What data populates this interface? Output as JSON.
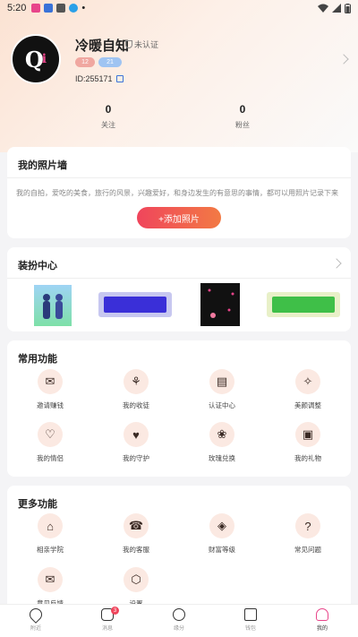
{
  "status": {
    "time": "5:20",
    "dot": "•"
  },
  "profile": {
    "nickname": "冷暖自知",
    "verify_label": "未认证",
    "badge_level": "12",
    "badge_blue": "21",
    "user_id": "ID:255171"
  },
  "stats": [
    {
      "value": "0",
      "label": "关注"
    },
    {
      "value": "0",
      "label": "粉丝"
    }
  ],
  "photo_wall": {
    "title": "我的照片墙",
    "description": "我的自拍，爱吃的美食，旅行的风景，兴趣爱好，和身边发生的有意思的事情，都可以用照片记录下来",
    "add_button": "+添加照片"
  },
  "dress_center": {
    "title": "装扮中心"
  },
  "common_functions": {
    "title": "常用功能",
    "items": [
      {
        "label": "邀请赚钱",
        "icon": "invite-user-icon"
      },
      {
        "label": "我的收徒",
        "icon": "disciple-icon"
      },
      {
        "label": "认证中心",
        "icon": "id-card-icon"
      },
      {
        "label": "美颜调整",
        "icon": "beauty-icon"
      },
      {
        "label": "我的情侣",
        "icon": "couple-icon"
      },
      {
        "label": "我的守护",
        "icon": "guard-icon"
      },
      {
        "label": "玫瑰兑换",
        "icon": "rose-icon"
      },
      {
        "label": "我的礼物",
        "icon": "gift-icon"
      }
    ]
  },
  "more_functions": {
    "title": "更多功能",
    "items": [
      {
        "label": "相亲学院",
        "icon": "school-icon"
      },
      {
        "label": "我的客服",
        "icon": "customer-service-icon"
      },
      {
        "label": "财富等级",
        "icon": "wealth-icon"
      },
      {
        "label": "常见问题",
        "icon": "question-icon"
      },
      {
        "label": "意见反馈",
        "icon": "feedback-icon"
      },
      {
        "label": "设置",
        "icon": "settings-icon"
      }
    ]
  },
  "tabbar": [
    {
      "label": "附近",
      "icon": "location-icon"
    },
    {
      "label": "消息",
      "icon": "message-icon",
      "badge": "3"
    },
    {
      "label": "缘分",
      "icon": "heart-icon"
    },
    {
      "label": "钱包",
      "icon": "wallet-icon"
    },
    {
      "label": "我的",
      "icon": "profile-icon",
      "active": true
    }
  ],
  "colors": {
    "accent_gradient_start": "#f0455c",
    "accent_gradient_end": "#f27a44",
    "icon_bg": "#fbe9e2"
  }
}
